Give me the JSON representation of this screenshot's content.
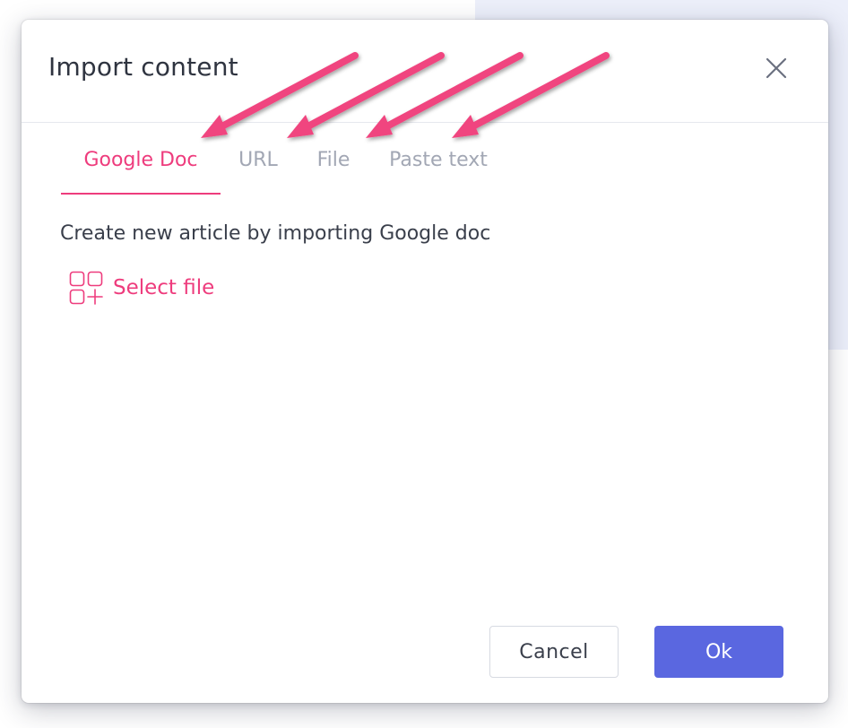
{
  "dialog": {
    "title": "Import content",
    "tabs": [
      {
        "label": "Google Doc",
        "active": true
      },
      {
        "label": "URL",
        "active": false
      },
      {
        "label": "File",
        "active": false
      },
      {
        "label": "Paste text",
        "active": false
      }
    ],
    "description": "Create new article by importing Google doc",
    "select_file_label": "Select file",
    "cancel_label": "Cancel",
    "ok_label": "Ok"
  },
  "colors": {
    "accent": "#ee3c7d",
    "primary_button": "#5a67e0",
    "arrow": "#f0447f",
    "inactive_tab": "#a2a7b4"
  },
  "icons": {
    "close": "close-icon",
    "select_file": "grid-plus-icon"
  },
  "annotation": {
    "arrow_count": 4
  }
}
